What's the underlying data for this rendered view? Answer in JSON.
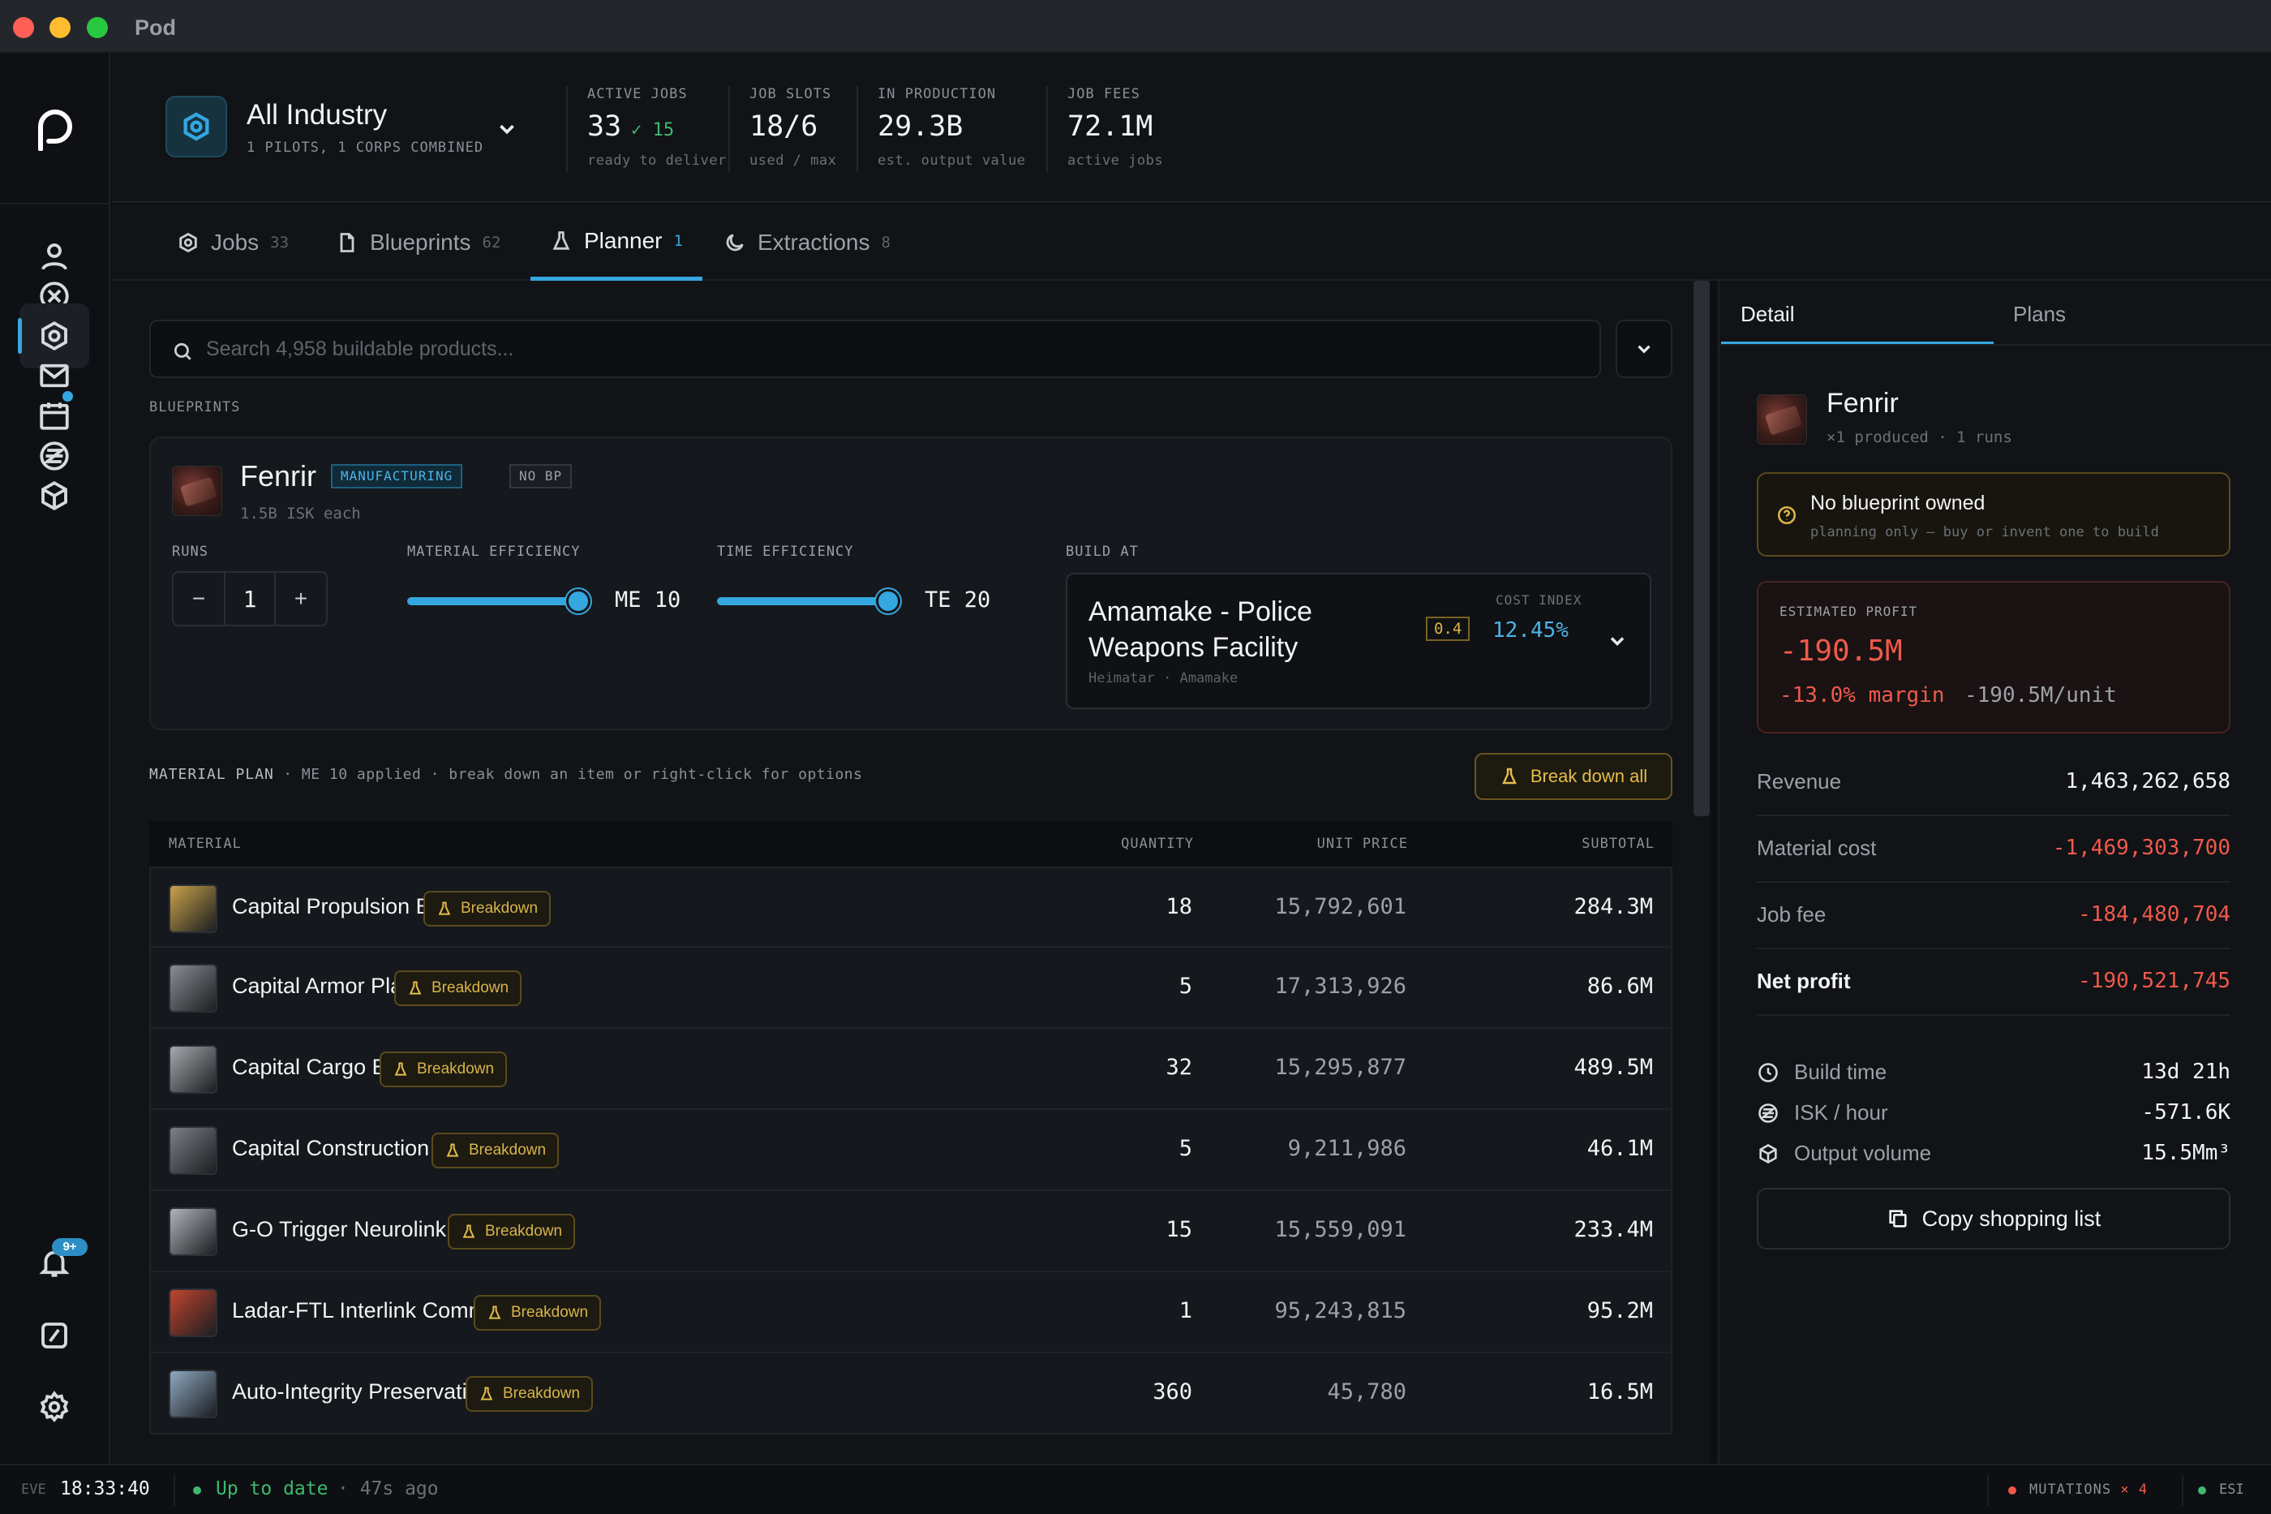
{
  "window": {
    "title": "Pod"
  },
  "header": {
    "workspace": {
      "name": "All Industry",
      "subtitle": "1 PILOTS, 1 CORPS COMBINED"
    },
    "stats": [
      {
        "label": "ACTIVE JOBS",
        "value": "33",
        "extra": "✓ 15",
        "sub": "ready to deliver"
      },
      {
        "label": "JOB SLOTS",
        "value": "18/6",
        "sub": "used / max"
      },
      {
        "label": "IN PRODUCTION",
        "value": "29.3B",
        "sub": "est. output value"
      },
      {
        "label": "JOB FEES",
        "value": "72.1M",
        "sub": "active jobs"
      }
    ]
  },
  "tabs": [
    {
      "label": "Jobs",
      "count": "33",
      "icon": "gear-icon"
    },
    {
      "label": "Blueprints",
      "count": "62",
      "icon": "document-icon"
    },
    {
      "label": "Planner",
      "count": "1",
      "icon": "flask-icon"
    },
    {
      "label": "Extractions",
      "count": "8",
      "icon": "moon-icon"
    }
  ],
  "planner": {
    "search_placeholder": "Search 4,958 buildable products...",
    "section_blueprints": "BLUEPRINTS",
    "blueprint": {
      "name": "Fenrir",
      "tag_activity": "MANUFACTURING",
      "tag_bp": "NO BP",
      "sub": "1.5B ISK each",
      "runs_label": "RUNS",
      "runs": "1",
      "minus": "−",
      "plus": "+",
      "me_label": "MATERIAL EFFICIENCY",
      "me_value": "ME 10",
      "me_level": 1.0,
      "te_label": "TIME EFFICIENCY",
      "te_value": "TE 20",
      "te_level": 1.0,
      "build_label": "BUILD AT",
      "facility": {
        "name": "Amamake - Police Weapons Facility",
        "sub": "Heimatar · Amamake",
        "security": "0.4",
        "cost_index_label": "COST INDEX",
        "cost_index": "12.45%"
      }
    },
    "plan_label": "MATERIAL PLAN",
    "plan_hint": "· ME 10 applied · break down an item or right-click for options",
    "break_all": "Break down all",
    "columns": {
      "material": "MATERIAL",
      "quantity": "QUANTITY",
      "unit_price": "UNIT PRICE",
      "subtotal": "SUBTOTAL"
    },
    "breakdown_label": "Breakdown",
    "materials": [
      {
        "name": "Capital Propulsion Engine",
        "qty": "18",
        "price": "15,792,601",
        "subtotal": "284.3M",
        "color": "#c9a24a"
      },
      {
        "name": "Capital Armor Plates",
        "qty": "5",
        "price": "17,313,926",
        "subtotal": "86.6M",
        "color": "#8a8d92"
      },
      {
        "name": "Capital Cargo Bay",
        "qty": "32",
        "price": "15,295,877",
        "subtotal": "489.5M",
        "color": "#a6a9ad"
      },
      {
        "name": "Capital Construction Parts",
        "qty": "5",
        "price": "9,211,986",
        "subtotal": "46.1M",
        "color": "#7c7f84"
      },
      {
        "name": "G-O Trigger Neurolink Conduit",
        "qty": "15",
        "price": "15,559,091",
        "subtotal": "233.4M",
        "color": "#b0b3b8"
      },
      {
        "name": "Ladar-FTL Interlink Communicator",
        "qty": "1",
        "price": "95,243,815",
        "subtotal": "95.2M",
        "color": "#c0452f"
      },
      {
        "name": "Auto-Integrity Preservation Seal",
        "qty": "360",
        "price": "45,780",
        "subtotal": "16.5M",
        "color": "#8fa9c2"
      }
    ]
  },
  "detail": {
    "tab_detail": "Detail",
    "tab_plans": "Plans",
    "ship": "Fenrir",
    "ship_sub": "×1 produced · 1 runs",
    "warning_title": "No blueprint owned",
    "warning_sub": "planning only — buy or invent one to build",
    "profit_label": "ESTIMATED PROFIT",
    "profit": "-190.5M",
    "margin": "-13.0% margin",
    "per_unit": "-190.5M/unit",
    "rows": [
      {
        "label": "Revenue",
        "value": "1,463,262,658"
      },
      {
        "label": "Material cost",
        "value": "-1,469,303,700"
      },
      {
        "label": "Job fee",
        "value": "-184,480,704"
      },
      {
        "label": "Net profit",
        "value": "-190,521,745"
      }
    ],
    "metrics": [
      {
        "label": "Build time",
        "value": "13d 21h",
        "icon": "clock-icon"
      },
      {
        "label": "ISK / hour",
        "value": "-571.6K",
        "icon": "isk-icon"
      },
      {
        "label": "Output volume",
        "value": "15.5Mm³",
        "icon": "cube-icon"
      }
    ],
    "copy": "Copy shopping list"
  },
  "rail": {
    "notifications_badge": "9+"
  },
  "statusbar": {
    "eve_label": "EVE",
    "time": "18:33:40",
    "sync": "Up to date",
    "ago": "· 47s ago",
    "mutations_label": "MUTATIONS",
    "mutations_count": "× 4",
    "esi": "ESI"
  },
  "colors": {
    "accent": "#35a7e0",
    "negative": "#ef5a4a",
    "positive": "#3fb96e",
    "warning": "#d9b44a"
  }
}
